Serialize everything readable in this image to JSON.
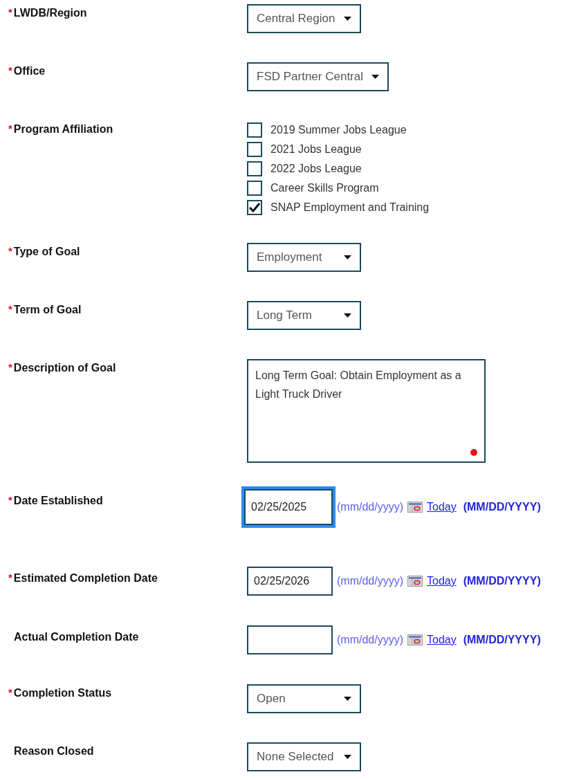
{
  "fields": [
    {
      "kind": "select",
      "required_mark": "*",
      "label": "LWDB/Region",
      "value": "Central Region"
    },
    {
      "kind": "select",
      "required_mark": "*",
      "label": "Office",
      "value": "FSD Partner Central"
    },
    {
      "kind": "checkboxes",
      "required_mark": "*",
      "label": "Program Affiliation",
      "options": [
        {
          "label": "2019 Summer Jobs League",
          "checked": false
        },
        {
          "label": "2021 Jobs League",
          "checked": false
        },
        {
          "label": "2022 Jobs League",
          "checked": false
        },
        {
          "label": "Career Skills Program",
          "checked": false
        },
        {
          "label": "SNAP Employment and Training",
          "checked": true
        }
      ]
    },
    {
      "kind": "select",
      "required_mark": "*",
      "label": "Type of Goal",
      "value": "Employment"
    },
    {
      "kind": "select",
      "required_mark": "*",
      "label": "Term of Goal",
      "value": "Long Term"
    },
    {
      "kind": "textarea",
      "required_mark": "*",
      "label": "Description of Goal",
      "value": "Long Term Goal: Obtain Employment as a Light Truck Driver"
    },
    {
      "kind": "date",
      "required_mark": "*",
      "label": "Date Established",
      "value": "02/25/2025",
      "focused": true,
      "hint": "(mm/dd/yyyy)",
      "link": "Today",
      "format": "(MM/DD/YYYY)"
    },
    {
      "kind": "date",
      "required_mark": "*",
      "label": "Estimated Completion Date",
      "value": "02/25/2026",
      "focused": false,
      "hint": "(mm/dd/yyyy)",
      "link": "Today",
      "format": "(MM/DD/YYYY)"
    },
    {
      "kind": "date",
      "label": "Actual Completion Date",
      "focused": false,
      "hint": "(mm/dd/yyyy)",
      "link": "Today",
      "format": "(MM/DD/YYYY)"
    },
    {
      "kind": "select",
      "required_mark": "*",
      "label": "Completion Status",
      "value": "Open"
    },
    {
      "kind": "select",
      "label": "Reason Closed",
      "value": "None Selected"
    }
  ]
}
